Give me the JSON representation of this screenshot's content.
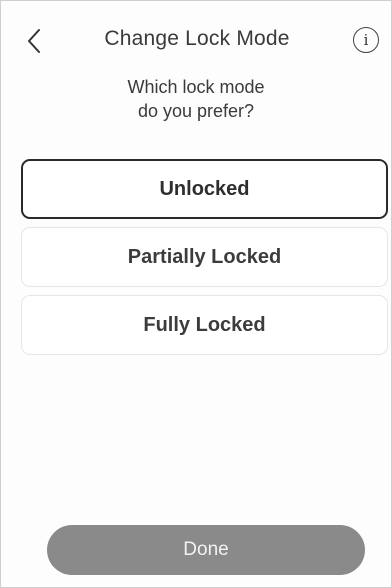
{
  "header": {
    "title": "Change Lock Mode",
    "info_glyph": "i",
    "back_icon": "chevron-left-icon"
  },
  "prompt": {
    "line1": "Which lock mode",
    "line2": "do you prefer?"
  },
  "options": [
    {
      "label": "Unlocked",
      "selected": true
    },
    {
      "label": "Partially Locked",
      "selected": false
    },
    {
      "label": "Fully Locked",
      "selected": false
    }
  ],
  "footer": {
    "done_label": "Done"
  },
  "colors": {
    "selected_border": "#2a2a2a",
    "done_button": "#8a8a8a"
  }
}
